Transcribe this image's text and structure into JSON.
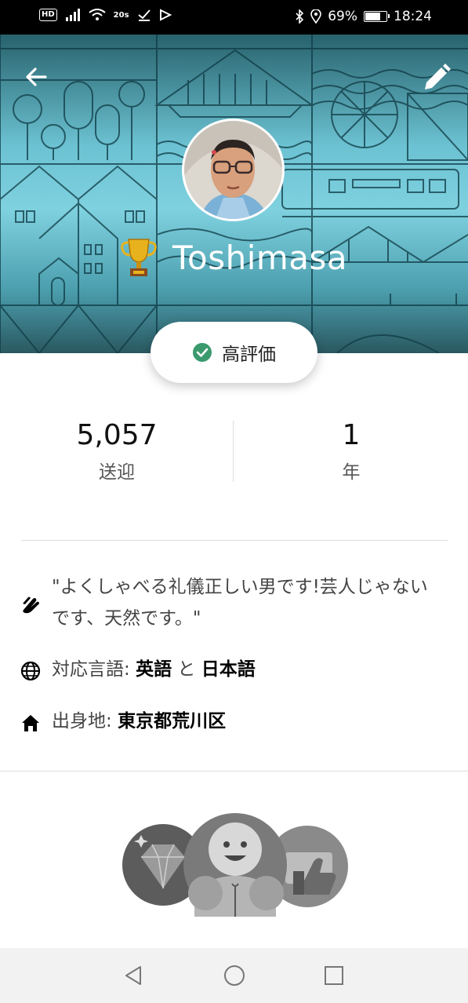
{
  "status_bar": {
    "hd": "HD",
    "speed": "20s",
    "battery": "69%",
    "time": "18:24"
  },
  "profile": {
    "name": "Toshimasa",
    "badge_label": "高評価"
  },
  "stats": [
    {
      "value": "5,057",
      "label": "送迎"
    },
    {
      "value": "1",
      "label": "年"
    }
  ],
  "about": {
    "quote": "\"よくしゃべる礼儀正しい男です!芸人じゃないです、天然です。\"",
    "languages_label": "対応言語:",
    "language_1": "英語",
    "languages_join": "と",
    "language_2": "日本語",
    "hometown_label": "出身地:",
    "hometown": "東京都荒川区"
  },
  "icons": {
    "back": "arrow-left-icon",
    "edit": "pencil-icon",
    "trophy": "trophy-icon",
    "verified": "check-circle-icon",
    "hello": "waving-hand-icon",
    "language": "globe-icon",
    "home": "home-icon",
    "nav_back": "triangle-back-icon",
    "nav_home": "circle-home-icon",
    "nav_recent": "square-recents-icon"
  },
  "colors": {
    "header_teal": "#6cc2d2",
    "check_green": "#3a9a6e",
    "trophy_gold": "#d9a21b"
  }
}
